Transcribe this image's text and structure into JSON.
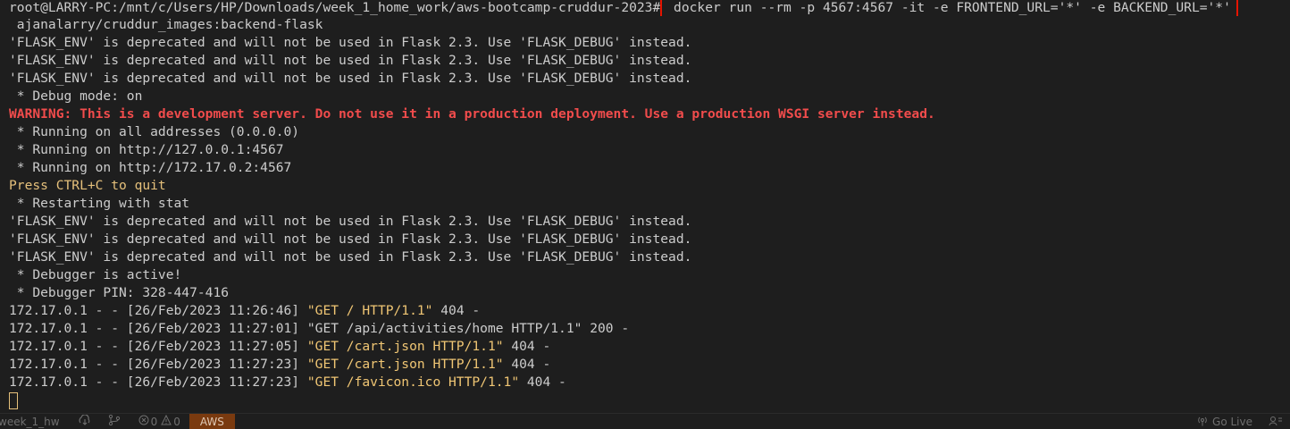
{
  "terminal": {
    "prompt": "root@LARRY-PC:/mnt/c/Users/HP/Downloads/week_1_home_work/aws-bootcamp-cruddur-2023#",
    "command": " docker run --rm -p 4567:4567 -it -e FRONTEND_URL='*' -e BACKEND_URL='*'",
    "command_cont": " ajanalarry/cruddur_images:backend-flask",
    "lines": [
      "'FLASK_ENV' is deprecated and will not be used in Flask 2.3. Use 'FLASK_DEBUG' instead.",
      "'FLASK_ENV' is deprecated and will not be used in Flask 2.3. Use 'FLASK_DEBUG' instead.",
      "'FLASK_ENV' is deprecated and will not be used in Flask 2.3. Use 'FLASK_DEBUG' instead.",
      " * Debug mode: on",
      "WARNING: This is a development server. Do not use it in a production deployment. Use a production WSGI server instead.",
      " * Running on all addresses (0.0.0.0)",
      " * Running on http://127.0.0.1:4567",
      " * Running on http://172.17.0.2:4567",
      "Press CTRL+C to quit",
      " * Restarting with stat",
      "'FLASK_ENV' is deprecated and will not be used in Flask 2.3. Use 'FLASK_DEBUG' instead.",
      "'FLASK_ENV' is deprecated and will not be used in Flask 2.3. Use 'FLASK_DEBUG' instead.",
      "'FLASK_ENV' is deprecated and will not be used in Flask 2.3. Use 'FLASK_DEBUG' instead.",
      " * Debugger is active!",
      " * Debugger PIN: 328-447-416"
    ],
    "requests": [
      {
        "prefix": "172.17.0.1 - - [26/Feb/2023 11:26:46] ",
        "request": "\"GET / HTTP/1.1\"",
        "suffix": " 404 -",
        "highlight": true
      },
      {
        "prefix": "172.17.0.1 - - [26/Feb/2023 11:27:01] ",
        "request": "\"GET /api/activities/home HTTP/1.1\"",
        "suffix": " 200 -",
        "highlight": false
      },
      {
        "prefix": "172.17.0.1 - - [26/Feb/2023 11:27:05] ",
        "request": "\"GET /cart.json HTTP/1.1\"",
        "suffix": " 404 -",
        "highlight": true
      },
      {
        "prefix": "172.17.0.1 - - [26/Feb/2023 11:27:23] ",
        "request": "\"GET /cart.json HTTP/1.1\"",
        "suffix": " 404 -",
        "highlight": true
      },
      {
        "prefix": "172.17.0.1 - - [26/Feb/2023 11:27:23] ",
        "request": "\"GET /favicon.ico HTTP/1.1\"",
        "suffix": " 404 -",
        "highlight": true
      }
    ]
  },
  "statusbar": {
    "branch": "week_1_hw",
    "errors": "0",
    "warnings": "0",
    "aws_label": "AWS",
    "go_live": "Go Live",
    "icons": [
      "sync-icon",
      "branch-icon",
      "error-icon",
      "warning-icon",
      "broadcast-icon",
      "feedback-icon"
    ]
  },
  "colors": {
    "background": "#1e1e1e",
    "text": "#cccccc",
    "warning": "#f14c4c",
    "highlight": "#f0c674",
    "command_box": "#e51400",
    "aws_badge": "#7a3a0f"
  }
}
